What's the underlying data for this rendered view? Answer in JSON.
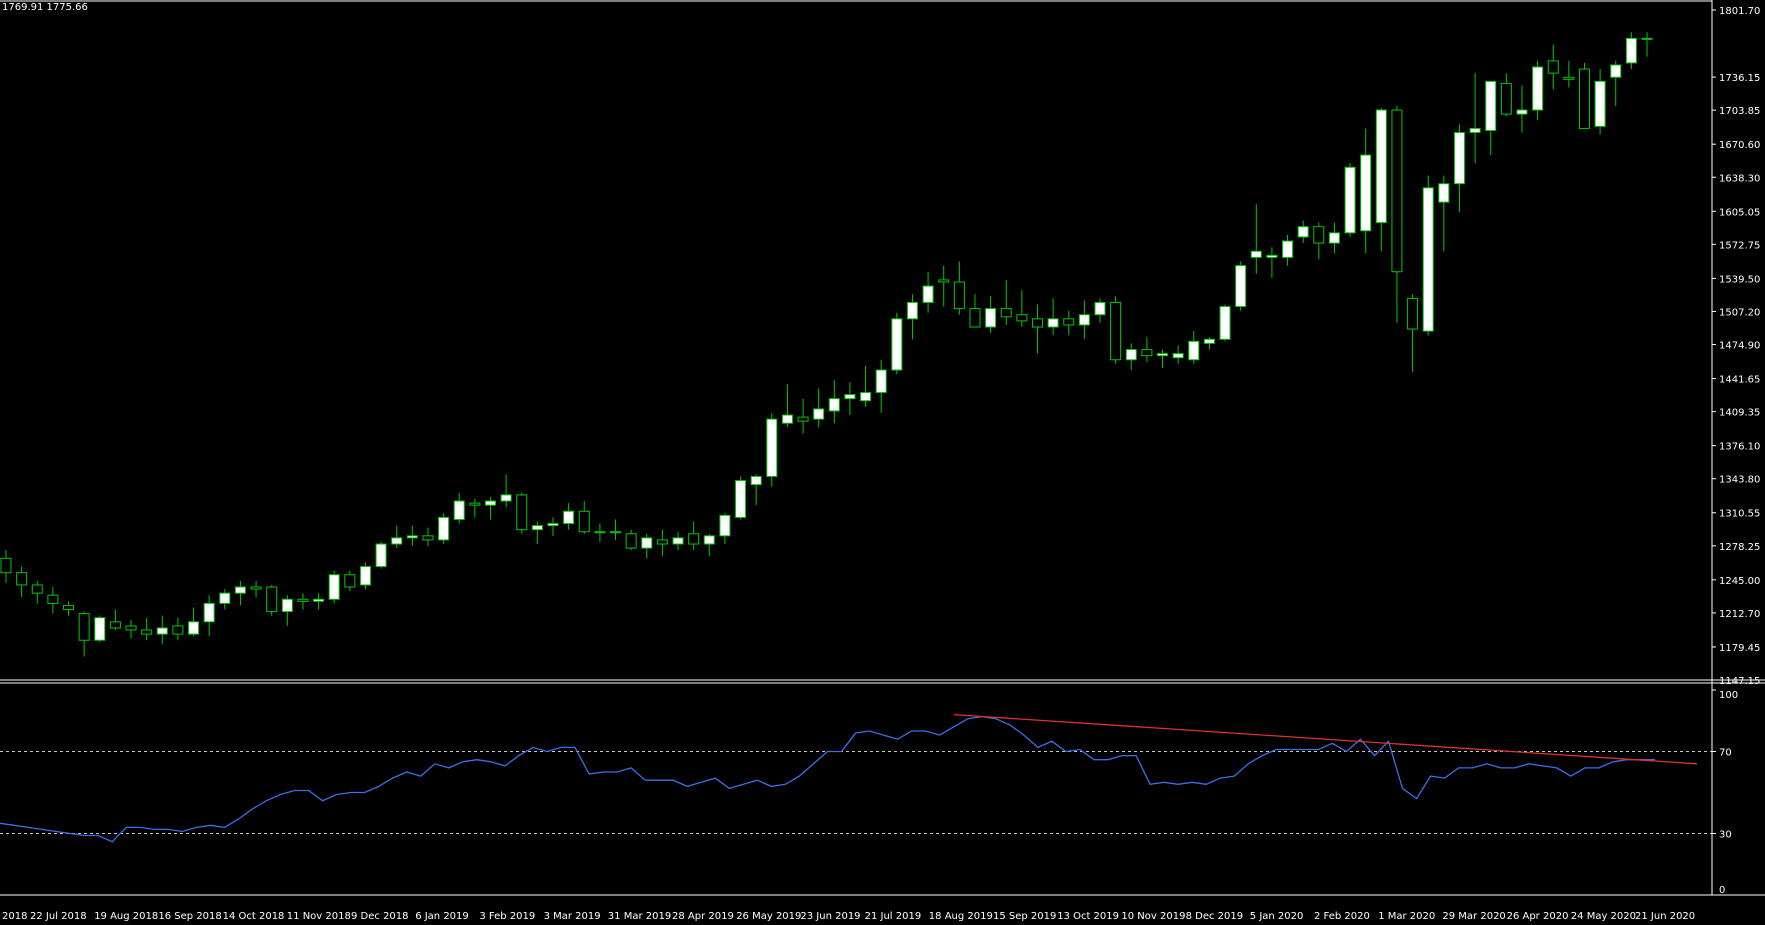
{
  "header": {
    "ohlc_readout": "1769.91 1775.66"
  },
  "colors": {
    "background": "#000000",
    "bull_body": "#ffffff",
    "bear_body": "#000000",
    "wick": "#00c800",
    "grid_line": "#ffffff",
    "axis_text": "#ffffff",
    "rsi_line": "#3c6ee6",
    "trend_line": "#e03030",
    "rsi_levels": "#c8c8c8"
  },
  "chart_data": [
    {
      "type": "candlestick",
      "timeframe": "weekly",
      "ylim": [
        1147.15,
        1801.7
      ],
      "y_tick_labels": [
        "1801.70",
        "1736.15",
        "1703.85",
        "1670.60",
        "1638.30",
        "1605.05",
        "1572.75",
        "1539.50",
        "1507.20",
        "1474.90",
        "1441.65",
        "1409.35",
        "1376.10",
        "1343.80",
        "1310.55",
        "1278.25",
        "1245.00",
        "1212.70",
        "1179.45",
        "1147.15"
      ],
      "x_tick_labels": [
        "2018",
        "22 Jul 2018",
        "19 Aug 2018",
        "16 Sep 2018",
        "14 Oct 2018",
        "11 Nov 2018",
        "9 Dec 2018",
        "6 Jan 2019",
        "3 Feb 2019",
        "3 Mar 2019",
        "31 Mar 2019",
        "28 Apr 2019",
        "26 May 2019",
        "23 Jun 2019",
        "21 Jul 2019",
        "18 Aug 2019",
        "15 Sep 2019",
        "13 Oct 2019",
        "10 Nov 2019",
        "8 Dec 2019",
        "5 Jan 2020",
        "2 Feb 2020",
        "1 Mar 2020",
        "29 Mar 2020",
        "26 Apr 2020",
        "24 May 2020",
        "21 Jun 2020"
      ],
      "candles": [
        [
          1266,
          1274,
          1242,
          1252
        ],
        [
          1252,
          1258,
          1228,
          1240
        ],
        [
          1240,
          1244,
          1222,
          1232
        ],
        [
          1230,
          1238,
          1212,
          1222
        ],
        [
          1220,
          1224,
          1210,
          1216
        ],
        [
          1212,
          1214,
          1170,
          1186
        ],
        [
          1186,
          1210,
          1184,
          1208
        ],
        [
          1204,
          1216,
          1196,
          1198
        ],
        [
          1200,
          1206,
          1188,
          1196
        ],
        [
          1196,
          1208,
          1186,
          1192
        ],
        [
          1192,
          1210,
          1182,
          1198
        ],
        [
          1200,
          1208,
          1186,
          1192
        ],
        [
          1192,
          1218,
          1190,
          1204
        ],
        [
          1204,
          1230,
          1190,
          1222
        ],
        [
          1222,
          1236,
          1216,
          1232
        ],
        [
          1232,
          1244,
          1220,
          1238
        ],
        [
          1238,
          1244,
          1228,
          1236
        ],
        [
          1238,
          1240,
          1210,
          1214
        ],
        [
          1214,
          1230,
          1200,
          1226
        ],
        [
          1226,
          1232,
          1216,
          1224
        ],
        [
          1224,
          1232,
          1216,
          1226
        ],
        [
          1226,
          1254,
          1222,
          1250
        ],
        [
          1250,
          1254,
          1234,
          1238
        ],
        [
          1240,
          1262,
          1236,
          1258
        ],
        [
          1258,
          1282,
          1256,
          1280
        ],
        [
          1280,
          1298,
          1276,
          1286
        ],
        [
          1286,
          1298,
          1278,
          1288
        ],
        [
          1288,
          1296,
          1278,
          1284
        ],
        [
          1284,
          1310,
          1280,
          1306
        ],
        [
          1304,
          1330,
          1300,
          1322
        ],
        [
          1320,
          1324,
          1306,
          1318
        ],
        [
          1318,
          1326,
          1304,
          1322
        ],
        [
          1322,
          1348,
          1316,
          1328
        ],
        [
          1328,
          1330,
          1290,
          1294
        ],
        [
          1294,
          1302,
          1280,
          1298
        ],
        [
          1298,
          1306,
          1288,
          1300
        ],
        [
          1300,
          1320,
          1294,
          1312
        ],
        [
          1312,
          1322,
          1290,
          1292
        ],
        [
          1292,
          1300,
          1282,
          1292
        ],
        [
          1292,
          1304,
          1284,
          1292
        ],
        [
          1290,
          1294,
          1274,
          1276
        ],
        [
          1276,
          1290,
          1266,
          1286
        ],
        [
          1284,
          1294,
          1268,
          1280
        ],
        [
          1280,
          1292,
          1274,
          1286
        ],
        [
          1290,
          1302,
          1274,
          1280
        ],
        [
          1280,
          1290,
          1268,
          1288
        ],
        [
          1288,
          1310,
          1280,
          1308
        ],
        [
          1306,
          1346,
          1304,
          1342
        ],
        [
          1338,
          1348,
          1318,
          1346
        ],
        [
          1346,
          1408,
          1336,
          1402
        ],
        [
          1398,
          1436,
          1394,
          1406
        ],
        [
          1404,
          1422,
          1388,
          1400
        ],
        [
          1402,
          1432,
          1394,
          1412
        ],
        [
          1410,
          1440,
          1398,
          1422
        ],
        [
          1422,
          1438,
          1406,
          1426
        ],
        [
          1420,
          1454,
          1414,
          1428
        ],
        [
          1428,
          1460,
          1408,
          1450
        ],
        [
          1450,
          1506,
          1446,
          1500
        ],
        [
          1500,
          1524,
          1480,
          1516
        ],
        [
          1516,
          1546,
          1506,
          1532
        ],
        [
          1538,
          1552,
          1512,
          1536
        ],
        [
          1536,
          1556,
          1504,
          1510
        ],
        [
          1510,
          1524,
          1494,
          1492
        ],
        [
          1492,
          1522,
          1486,
          1510
        ],
        [
          1510,
          1538,
          1494,
          1502
        ],
        [
          1504,
          1528,
          1492,
          1498
        ],
        [
          1500,
          1514,
          1466,
          1492
        ],
        [
          1492,
          1520,
          1484,
          1500
        ],
        [
          1500,
          1508,
          1484,
          1494
        ],
        [
          1494,
          1518,
          1480,
          1504
        ],
        [
          1504,
          1520,
          1496,
          1516
        ],
        [
          1516,
          1522,
          1456,
          1460
        ],
        [
          1460,
          1476,
          1450,
          1470
        ],
        [
          1470,
          1482,
          1458,
          1464
        ],
        [
          1464,
          1470,
          1452,
          1466
        ],
        [
          1462,
          1474,
          1456,
          1466
        ],
        [
          1460,
          1488,
          1456,
          1478
        ],
        [
          1476,
          1482,
          1470,
          1480
        ],
        [
          1480,
          1514,
          1478,
          1512
        ],
        [
          1512,
          1556,
          1508,
          1552
        ],
        [
          1560,
          1612,
          1544,
          1566
        ],
        [
          1560,
          1570,
          1540,
          1562
        ],
        [
          1560,
          1582,
          1552,
          1576
        ],
        [
          1580,
          1596,
          1574,
          1590
        ],
        [
          1590,
          1594,
          1558,
          1574
        ],
        [
          1574,
          1594,
          1564,
          1584
        ],
        [
          1584,
          1652,
          1580,
          1648
        ],
        [
          1586,
          1686,
          1564,
          1660
        ],
        [
          1594,
          1706,
          1566,
          1704
        ],
        [
          1704,
          1708,
          1496,
          1546
        ],
        [
          1520,
          1524,
          1448,
          1490
        ],
        [
          1488,
          1640,
          1484,
          1628
        ],
        [
          1614,
          1640,
          1566,
          1632
        ],
        [
          1632,
          1690,
          1604,
          1682
        ],
        [
          1682,
          1740,
          1652,
          1686
        ],
        [
          1684,
          1732,
          1660,
          1732
        ],
        [
          1730,
          1740,
          1698,
          1700
        ],
        [
          1700,
          1728,
          1682,
          1704
        ],
        [
          1704,
          1752,
          1694,
          1746
        ],
        [
          1752,
          1768,
          1724,
          1740
        ],
        [
          1736,
          1752,
          1726,
          1734
        ],
        [
          1744,
          1750,
          1700,
          1686
        ],
        [
          1688,
          1744,
          1680,
          1732
        ],
        [
          1736,
          1752,
          1708,
          1748
        ],
        [
          1750,
          1780,
          1744,
          1774
        ],
        [
          1774,
          1780,
          1756,
          1774
        ]
      ]
    },
    {
      "type": "line",
      "indicator": "RSI",
      "ylim": [
        0,
        100
      ],
      "y_tick_labels": [
        "100",
        "70",
        "30",
        "0"
      ],
      "levels": [
        70,
        30
      ],
      "series": [
        {
          "values": [
            35,
            34,
            33,
            32,
            31,
            30,
            29,
            29,
            26,
            33,
            33,
            32,
            32,
            31,
            33,
            34,
            33,
            37,
            42,
            46,
            49,
            51,
            51,
            46,
            49,
            50,
            50,
            53,
            57,
            60,
            58,
            64,
            62,
            65,
            66,
            65,
            63,
            68,
            72,
            70,
            72,
            72,
            59,
            60,
            60,
            62,
            56,
            56,
            56,
            53,
            55,
            57,
            52,
            54,
            56,
            53,
            54,
            58,
            64,
            70,
            70,
            79,
            80,
            78,
            76,
            80,
            80,
            78,
            82,
            86,
            87,
            86,
            83,
            78,
            72,
            75,
            70,
            71,
            66,
            66,
            68,
            68,
            54,
            55,
            54,
            55,
            54,
            57,
            58,
            64,
            68,
            71,
            71,
            71,
            71,
            74,
            70,
            76,
            68,
            75,
            52,
            47,
            58,
            57,
            62,
            62,
            64,
            62,
            62,
            64,
            63,
            62,
            58,
            62,
            62,
            65,
            66,
            66,
            66
          ]
        }
      ],
      "trend_line": {
        "from": [
          68,
          88
        ],
        "to": [
          121,
          64
        ]
      }
    }
  ]
}
